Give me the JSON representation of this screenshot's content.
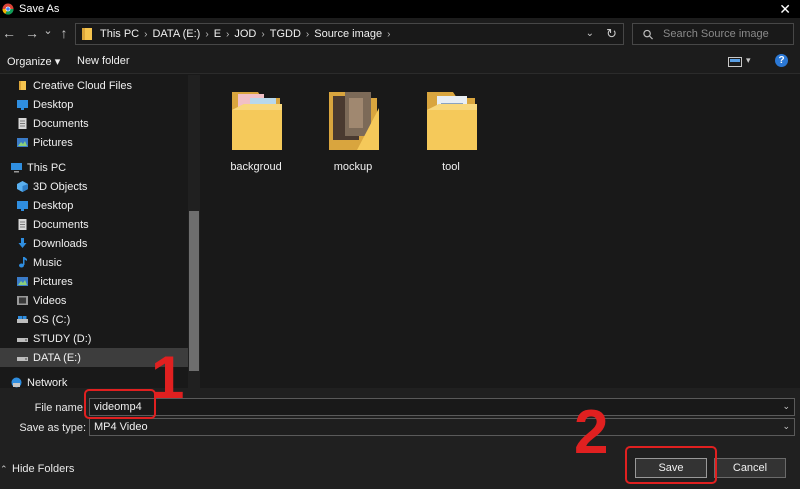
{
  "window": {
    "title": "Save As",
    "close_glyph": "✕"
  },
  "nav": {
    "back_glyph": "←",
    "forward_glyph": "→",
    "dropdown_glyph": "⌄",
    "up_glyph": "↑",
    "breadcrumbs": [
      "This PC",
      "DATA (E:)",
      "E",
      "JOD",
      "TGDD",
      "Source image"
    ],
    "crumb_separator": "›",
    "refresh_glyph": "↻"
  },
  "search": {
    "placeholder": "Search Source image"
  },
  "toolbar": {
    "organize_label": "Organize ▾",
    "new_folder_label": "New folder",
    "help_label": "?"
  },
  "sidebar": {
    "items": [
      {
        "label": "Creative Cloud Files",
        "icon": "cloud-folder-icon"
      },
      {
        "label": "Desktop",
        "icon": "desktop-icon"
      },
      {
        "label": "Documents",
        "icon": "documents-icon"
      },
      {
        "label": "Pictures",
        "icon": "pictures-icon"
      },
      {
        "label": "This PC",
        "icon": "computer-icon"
      },
      {
        "label": "3D Objects",
        "icon": "3d-objects-icon"
      },
      {
        "label": "Desktop",
        "icon": "desktop-icon"
      },
      {
        "label": "Documents",
        "icon": "documents-icon"
      },
      {
        "label": "Downloads",
        "icon": "downloads-icon"
      },
      {
        "label": "Music",
        "icon": "music-icon"
      },
      {
        "label": "Pictures",
        "icon": "pictures-icon"
      },
      {
        "label": "Videos",
        "icon": "videos-icon"
      },
      {
        "label": "OS (C:)",
        "icon": "drive-icon"
      },
      {
        "label": "STUDY (D:)",
        "icon": "drive-icon"
      },
      {
        "label": "DATA (E:)",
        "icon": "drive-icon",
        "selected": true
      },
      {
        "label": "Network",
        "icon": "network-icon"
      }
    ],
    "selected_background": "#3d3d3d"
  },
  "folders": [
    {
      "name": "backgroud"
    },
    {
      "name": "mockup"
    },
    {
      "name": "tool"
    }
  ],
  "form": {
    "file_name_label": "File name:",
    "file_name_value": "videomp4",
    "save_type_label": "Save as type:",
    "save_type_value": "MP4 Video",
    "hide_folders_label": "Hide Folders",
    "hide_folders_glyph": "⌃",
    "save_label": "Save",
    "cancel_label": "Cancel"
  },
  "annotations": [
    {
      "number": "1",
      "target": "file-name-field"
    },
    {
      "number": "2",
      "target": "save-button"
    }
  ],
  "colors": {
    "background": "#191919",
    "annotation": "#e02020",
    "folder": "#f5c34e",
    "help": "#2b78d5"
  }
}
